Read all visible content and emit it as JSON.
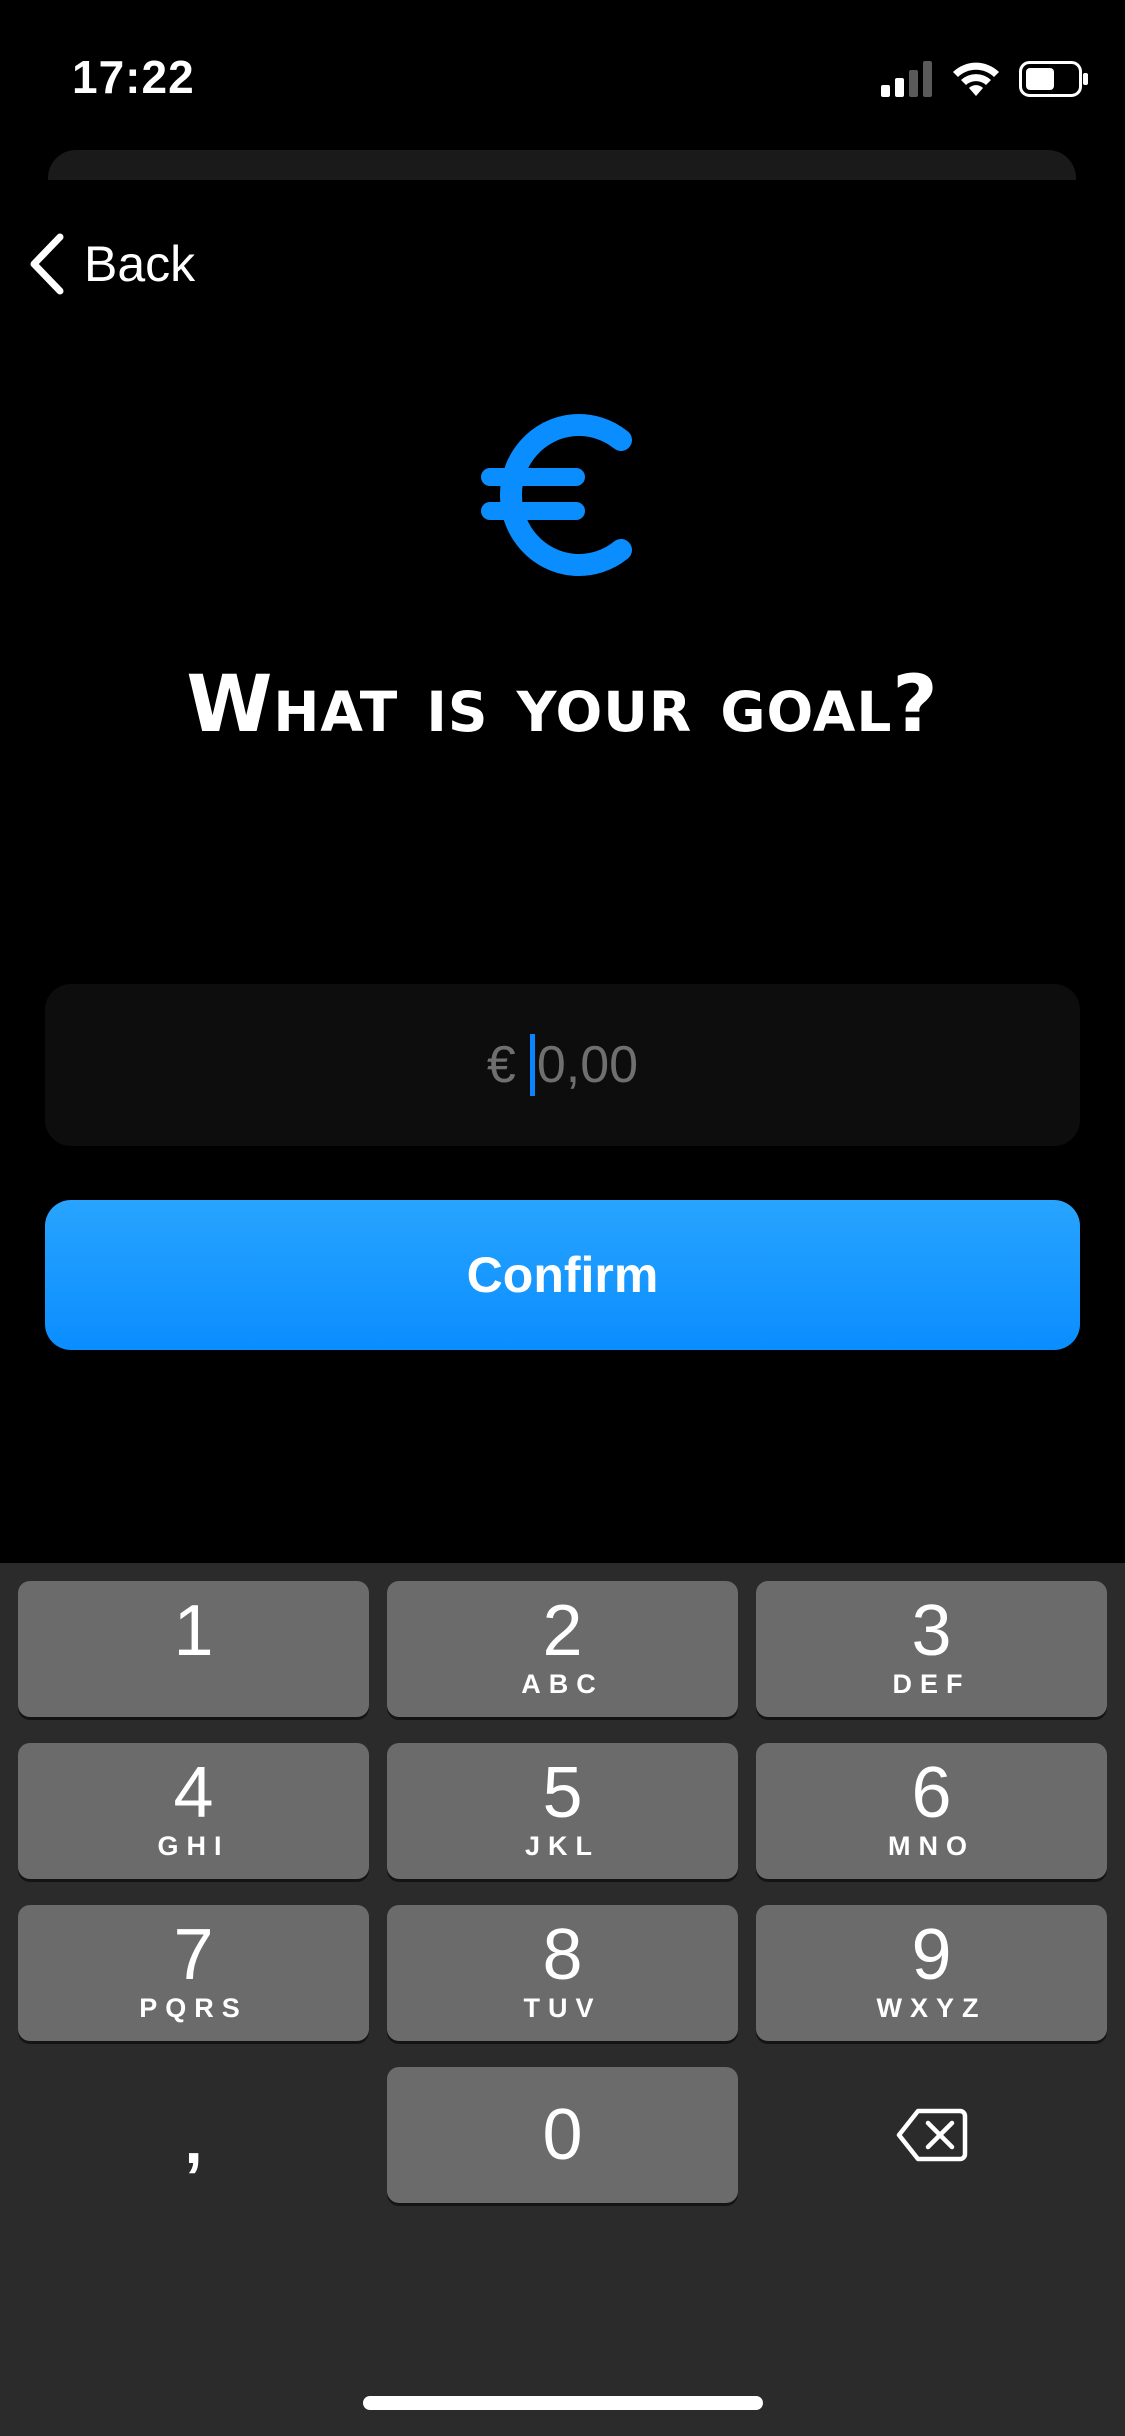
{
  "status_bar": {
    "time": "17:22"
  },
  "nav": {
    "back_label": "Back"
  },
  "page": {
    "title": "What is your goal?"
  },
  "amount_field": {
    "currency": "€",
    "placeholder": "0,00",
    "value": ""
  },
  "confirm": {
    "label": "Confirm"
  },
  "keypad": {
    "keys": [
      {
        "digit": "1",
        "letters": ""
      },
      {
        "digit": "2",
        "letters": "ABC"
      },
      {
        "digit": "3",
        "letters": "DEF"
      },
      {
        "digit": "4",
        "letters": "GHI"
      },
      {
        "digit": "5",
        "letters": "JKL"
      },
      {
        "digit": "6",
        "letters": "MNO"
      },
      {
        "digit": "7",
        "letters": "PQRS"
      },
      {
        "digit": "8",
        "letters": "TUV"
      },
      {
        "digit": "9",
        "letters": "WXYZ"
      },
      {
        "digit": "0",
        "letters": ""
      }
    ],
    "comma_label": ",",
    "delete_icon": "delete-backspace-icon"
  },
  "colors": {
    "accent": "#0a8dff",
    "background": "#000000",
    "keypad_bg": "#2b2b2b",
    "key_bg": "#6b6b6b"
  }
}
